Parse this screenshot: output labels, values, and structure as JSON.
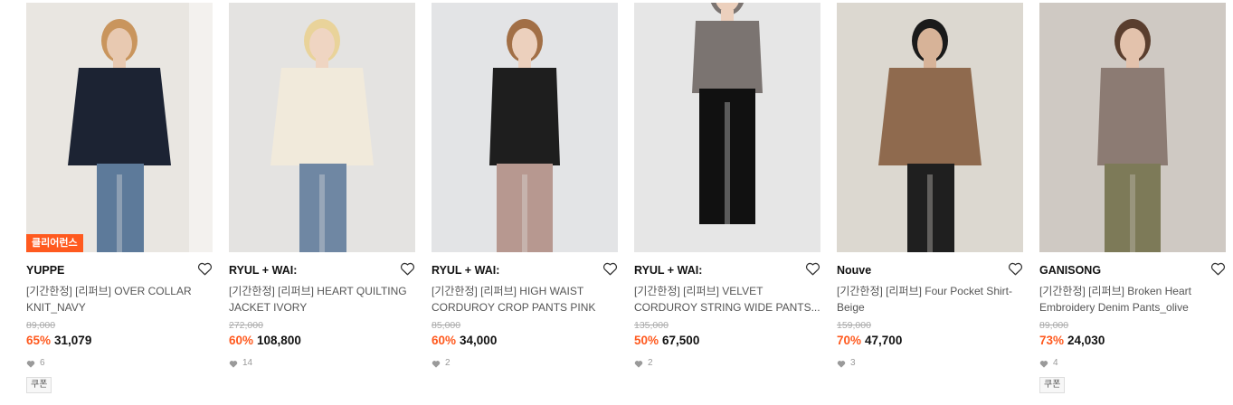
{
  "products": [
    {
      "badge": "클리어런스",
      "brand": "YUPPE",
      "title": "[기간한정] [리퍼브] OVER COLLAR KNIT_NAVY",
      "original_price": "89,000",
      "discount": "65%",
      "price": "31,079",
      "likes": "6",
      "coupon": "쿠폰",
      "colors": {
        "bg": "#e9e6e1",
        "top": "#1c2333",
        "bottom": "#5d7a9a",
        "skin": "#e8c9b1",
        "hair": "#c9955d"
      }
    },
    {
      "badge": "",
      "brand": "RYUL + WAI:",
      "title": "[기간한정] [리퍼브] HEART QUILTING JACKET IVORY",
      "original_price": "272,000",
      "discount": "60%",
      "price": "108,800",
      "likes": "14",
      "coupon": "",
      "colors": {
        "bg": "#e4e3e1",
        "top": "#f1eadb",
        "bottom": "#6f87a3",
        "skin": "#efd5c2",
        "hair": "#e9d39a"
      }
    },
    {
      "badge": "",
      "brand": "RYUL + WAI:",
      "title": "[기간한정] [리퍼브] HIGH WAIST CORDUROY CROP PANTS PINK",
      "original_price": "85,000",
      "discount": "60%",
      "price": "34,000",
      "likes": "2",
      "coupon": "",
      "colors": {
        "bg": "#e3e4e6",
        "top": "#1e1e1e",
        "bottom": "#b79890",
        "skin": "#ecd0bd",
        "hair": "#a26f46"
      }
    },
    {
      "badge": "",
      "brand": "RYUL + WAI:",
      "title": "[기간한정] [리퍼브] VELVET CORDUROY STRING WIDE PANTS...",
      "original_price": "135,000",
      "discount": "50%",
      "price": "67,500",
      "likes": "2",
      "coupon": "",
      "colors": {
        "bg": "#e6e6e6",
        "top": "#7b7471",
        "bottom": "#111111",
        "skin": "#ecd0bd",
        "hair": "#7b7471"
      }
    },
    {
      "badge": "",
      "brand": "Nouve",
      "title": "[기간한정] [리퍼브] Four Pocket Shirt-Beige",
      "original_price": "159,000",
      "discount": "70%",
      "price": "47,700",
      "likes": "3",
      "coupon": "",
      "colors": {
        "bg": "#dcd8d0",
        "top": "#8f6a4e",
        "bottom": "#1f1f1f",
        "skin": "#d7b398",
        "hair": "#1a1a1a"
      }
    },
    {
      "badge": "",
      "brand": "GANISONG",
      "title": "[기간한정] [리퍼브] Broken Heart Embroidery Denim Pants_olive",
      "original_price": "89,000",
      "discount": "73%",
      "price": "24,030",
      "likes": "4",
      "coupon": "쿠폰",
      "colors": {
        "bg": "#cfc9c3",
        "top": "#8c7b73",
        "bottom": "#7d7a58",
        "skin": "#e3c2ac",
        "hair": "#5a3e2e"
      }
    }
  ],
  "accent_color": "#ff5a1f"
}
